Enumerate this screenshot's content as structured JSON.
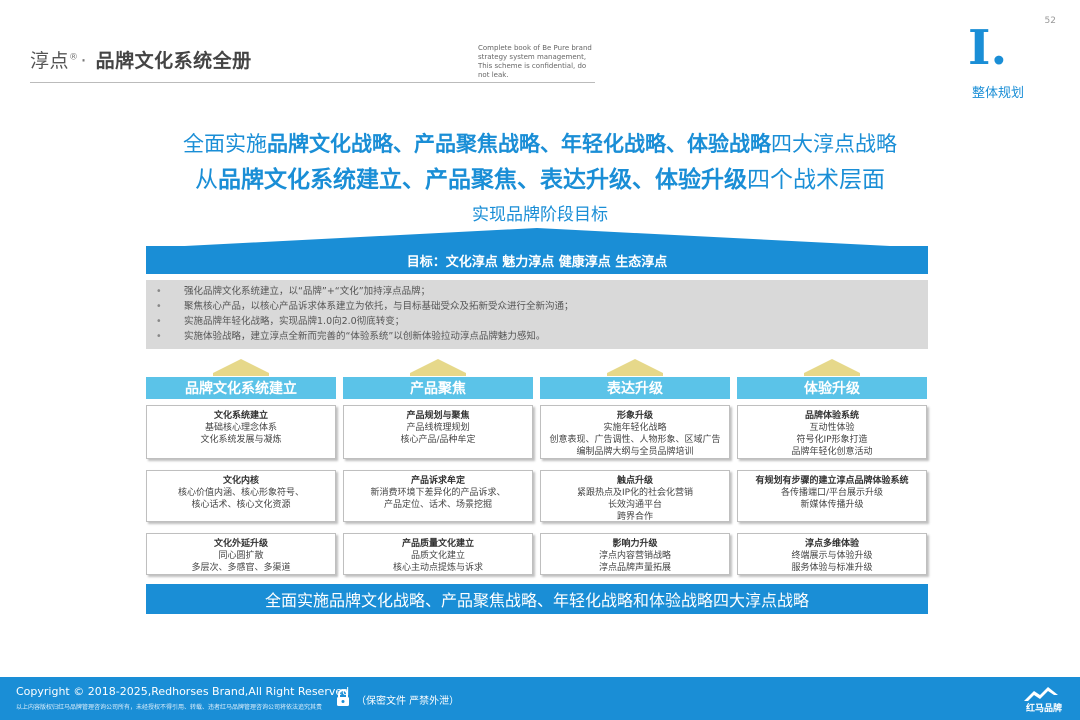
{
  "header": {
    "brand": "淳点",
    "brand_reg": "®",
    "dot": "·",
    "subtitle": "品牌文化系统全册",
    "note": "Complete book of Be Pure brand strategy system management, This scheme is confidential, do not leak.",
    "page_number": "52",
    "section_numeral": "I.",
    "section_label": "整体规划"
  },
  "headlines": {
    "line1_prefix": "全面实施",
    "line1_bold": "品牌文化战略、产品聚焦战略、年轻化战略、体验战略",
    "line1_suffix": "四大淳点战略",
    "line2_prefix": "从",
    "line2_bold": "品牌文化系统建立、产品聚焦、表达升级、体验升级",
    "line2_suffix": "四个战术层面",
    "line3": "实现品牌阶段目标"
  },
  "goal": {
    "text": "目标：文化淳点 魅力淳点 健康淳点 生态淳点"
  },
  "bullets": [
    "强化品牌文化系统建立，以“品牌”+“文化”加持淳点品牌；",
    "聚焦核心产品，以核心产品诉求体系建立为依托，与目标基础受众及拓新受众进行全新沟通；",
    "实施品牌年轻化战略，实现品牌1.0向2.0彻底转变；",
    "实施体验战略，建立淳点全新而完善的“体验系统”以创新体验拉动淳点品牌魅力感知。"
  ],
  "bullet_mark": "•",
  "pillars": [
    {
      "title": "品牌文化系统建立",
      "cells": [
        {
          "title": "文化系统建立",
          "lines": [
            "基础核心理念体系",
            "文化系统发展与凝炼"
          ]
        },
        {
          "title": "文化内核",
          "lines": [
            "核心价值内涵、核心形象符号、",
            "核心话术、核心文化资源"
          ]
        },
        {
          "title": "文化外延升级",
          "lines": [
            "同心圆扩散",
            "多层次、多感官、多渠道"
          ]
        }
      ]
    },
    {
      "title": "产品聚焦",
      "cells": [
        {
          "title": "产品规划与聚焦",
          "lines": [
            "产品线梳理规划",
            "核心产品/品种牟定"
          ]
        },
        {
          "title": "产品诉求牟定",
          "lines": [
            "新消费环境下差异化的产品诉求、",
            "产品定位、话术、场景挖掘"
          ]
        },
        {
          "title": "产品质量文化建立",
          "lines": [
            "品质文化建立",
            "核心主动点提炼与诉求"
          ]
        }
      ]
    },
    {
      "title": "表达升级",
      "cells": [
        {
          "title": "形象升级",
          "lines": [
            "实施年轻化战略",
            "创意表现、广告调性、人物形象、区域广告",
            "编制品牌大纲与全员品牌培训"
          ]
        },
        {
          "title": "触点升级",
          "lines": [
            "紧跟热点及IP化的社会化营销",
            "长效沟通平台",
            "跨界合作"
          ]
        },
        {
          "title": "影响力升级",
          "lines": [
            "淳点内容营销战略",
            "淳点品牌声量拓展"
          ]
        }
      ]
    },
    {
      "title": "体验升级",
      "cells": [
        {
          "title": "品牌体验系统",
          "lines": [
            "互动性体验",
            "符号化IP形象打造",
            "品牌年轻化创意活动"
          ]
        },
        {
          "title": "有规划有步骤的建立淳点品牌体验系统",
          "lines": [
            "各传播端口/平台展示升级",
            "新媒体传播升级"
          ]
        },
        {
          "title": "淳点多维体验",
          "lines": [
            "终端展示与体验升级",
            "服务体验与标准升级"
          ]
        }
      ]
    }
  ],
  "summary": {
    "text": "全面实施品牌文化战略、产品聚焦战略、年轻化战略和体验战略四大淳点战略"
  },
  "footer": {
    "copyright": "Copyright © 2018-2025,Redhorses Brand,All Right Reserved",
    "fine_print": "以上内容版权归红马品牌管理咨询公司所有，未经授权不得引用、转载、违者红马品牌管理咨询公司将依法追究其责",
    "confidential": "（保密文件 严禁外泄）",
    "logo_text": "红马品牌"
  },
  "colors": {
    "accent": "#1a8ed6",
    "pillar": "#5bc3e8",
    "arrow": "#e6d88a",
    "bullet_bg": "#d9d9d9"
  }
}
